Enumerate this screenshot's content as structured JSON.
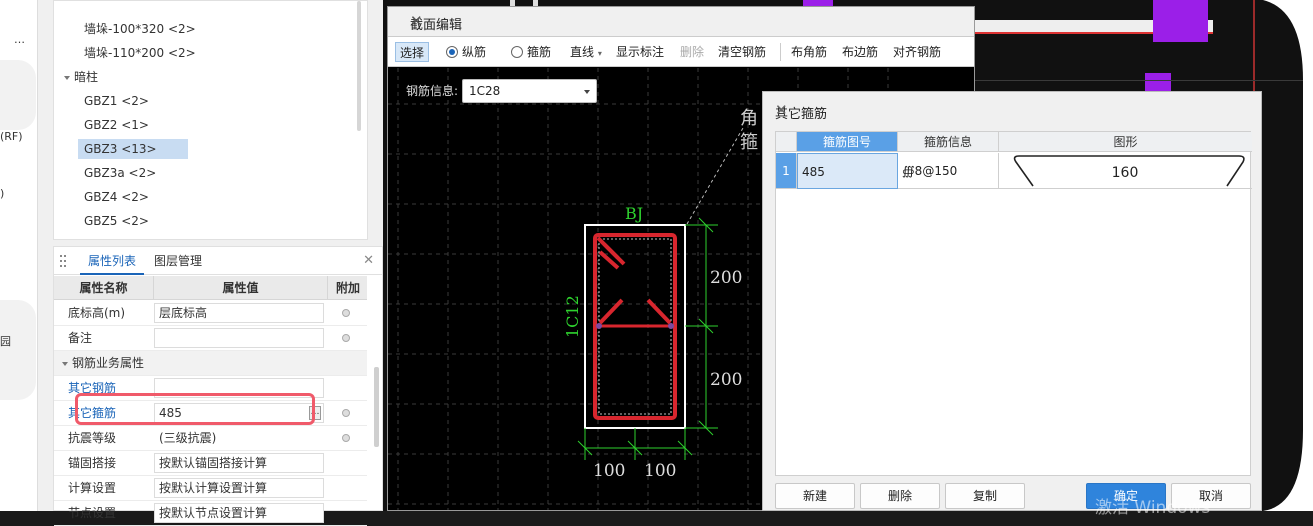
{
  "far_left": {
    "frag1": "…",
    "frag2": "(RF)",
    "frag3": ")",
    "frag4": "园"
  },
  "tree": {
    "items": [
      {
        "label": "墙垛-100*320 <2>"
      },
      {
        "label": "墙垛-110*200 <2>"
      },
      {
        "label": "暗柱"
      },
      {
        "label": "GBZ1 <2>"
      },
      {
        "label": "GBZ2 <1>"
      },
      {
        "label": "GBZ3 <13>"
      },
      {
        "label": "GBZ3a <2>"
      },
      {
        "label": "GBZ4 <2>"
      },
      {
        "label": "GBZ5 <2>"
      }
    ]
  },
  "props": {
    "tabs": [
      "属性列表",
      "图层管理"
    ],
    "head": {
      "name": "属性名称",
      "value": "属性值",
      "extra": "附加"
    },
    "rows": [
      {
        "name": "底标高(m)",
        "value": "层底标高"
      },
      {
        "name": "备注",
        "value": ""
      },
      {
        "name": "钢筋业务属性",
        "value": ""
      },
      {
        "name": "其它钢筋",
        "value": ""
      },
      {
        "name": "其它箍筋",
        "value": "485"
      },
      {
        "name": "抗震等级",
        "value": "(三级抗震)"
      },
      {
        "name": "锚固搭接",
        "value": "按默认锚固搭接计算"
      },
      {
        "name": "计算设置",
        "value": "按默认计算设置计算"
      },
      {
        "name": "节点设置",
        "value": "按默认节点设置计算"
      }
    ]
  },
  "section_win": {
    "title": "截面编辑",
    "toolbar": {
      "select": "选择",
      "longitudinal": "纵筋",
      "stirrup": "箍筋",
      "line": "直线",
      "show_label": "显示标注",
      "delete": "删除",
      "clear": "清空钢筋",
      "corner": "布角筋",
      "edge": "布边筋",
      "align": "对齐钢筋"
    },
    "rebar_info_label": "钢筋信息:",
    "rebar_info_value": "1C28",
    "drawing": {
      "top_label": "BJ",
      "side_label": "1C12",
      "dim_upper": "200",
      "dim_lower": "200",
      "dim_left": "100",
      "dim_right": "100",
      "callout1": "角",
      "callout2": "箍"
    }
  },
  "stirrup_dlg": {
    "title": "其它箍筋",
    "columns": [
      "箍筋图号",
      "箍筋信息",
      "图形"
    ],
    "rows": [
      {
        "index": "1",
        "code": "485",
        "info": "∰8@150",
        "shape_value": "160"
      }
    ],
    "buttons": {
      "new": "新建",
      "delete": "删除",
      "copy": "复制",
      "ok": "确定",
      "cancel": "取消"
    }
  },
  "watermark": "激活 Windows"
}
